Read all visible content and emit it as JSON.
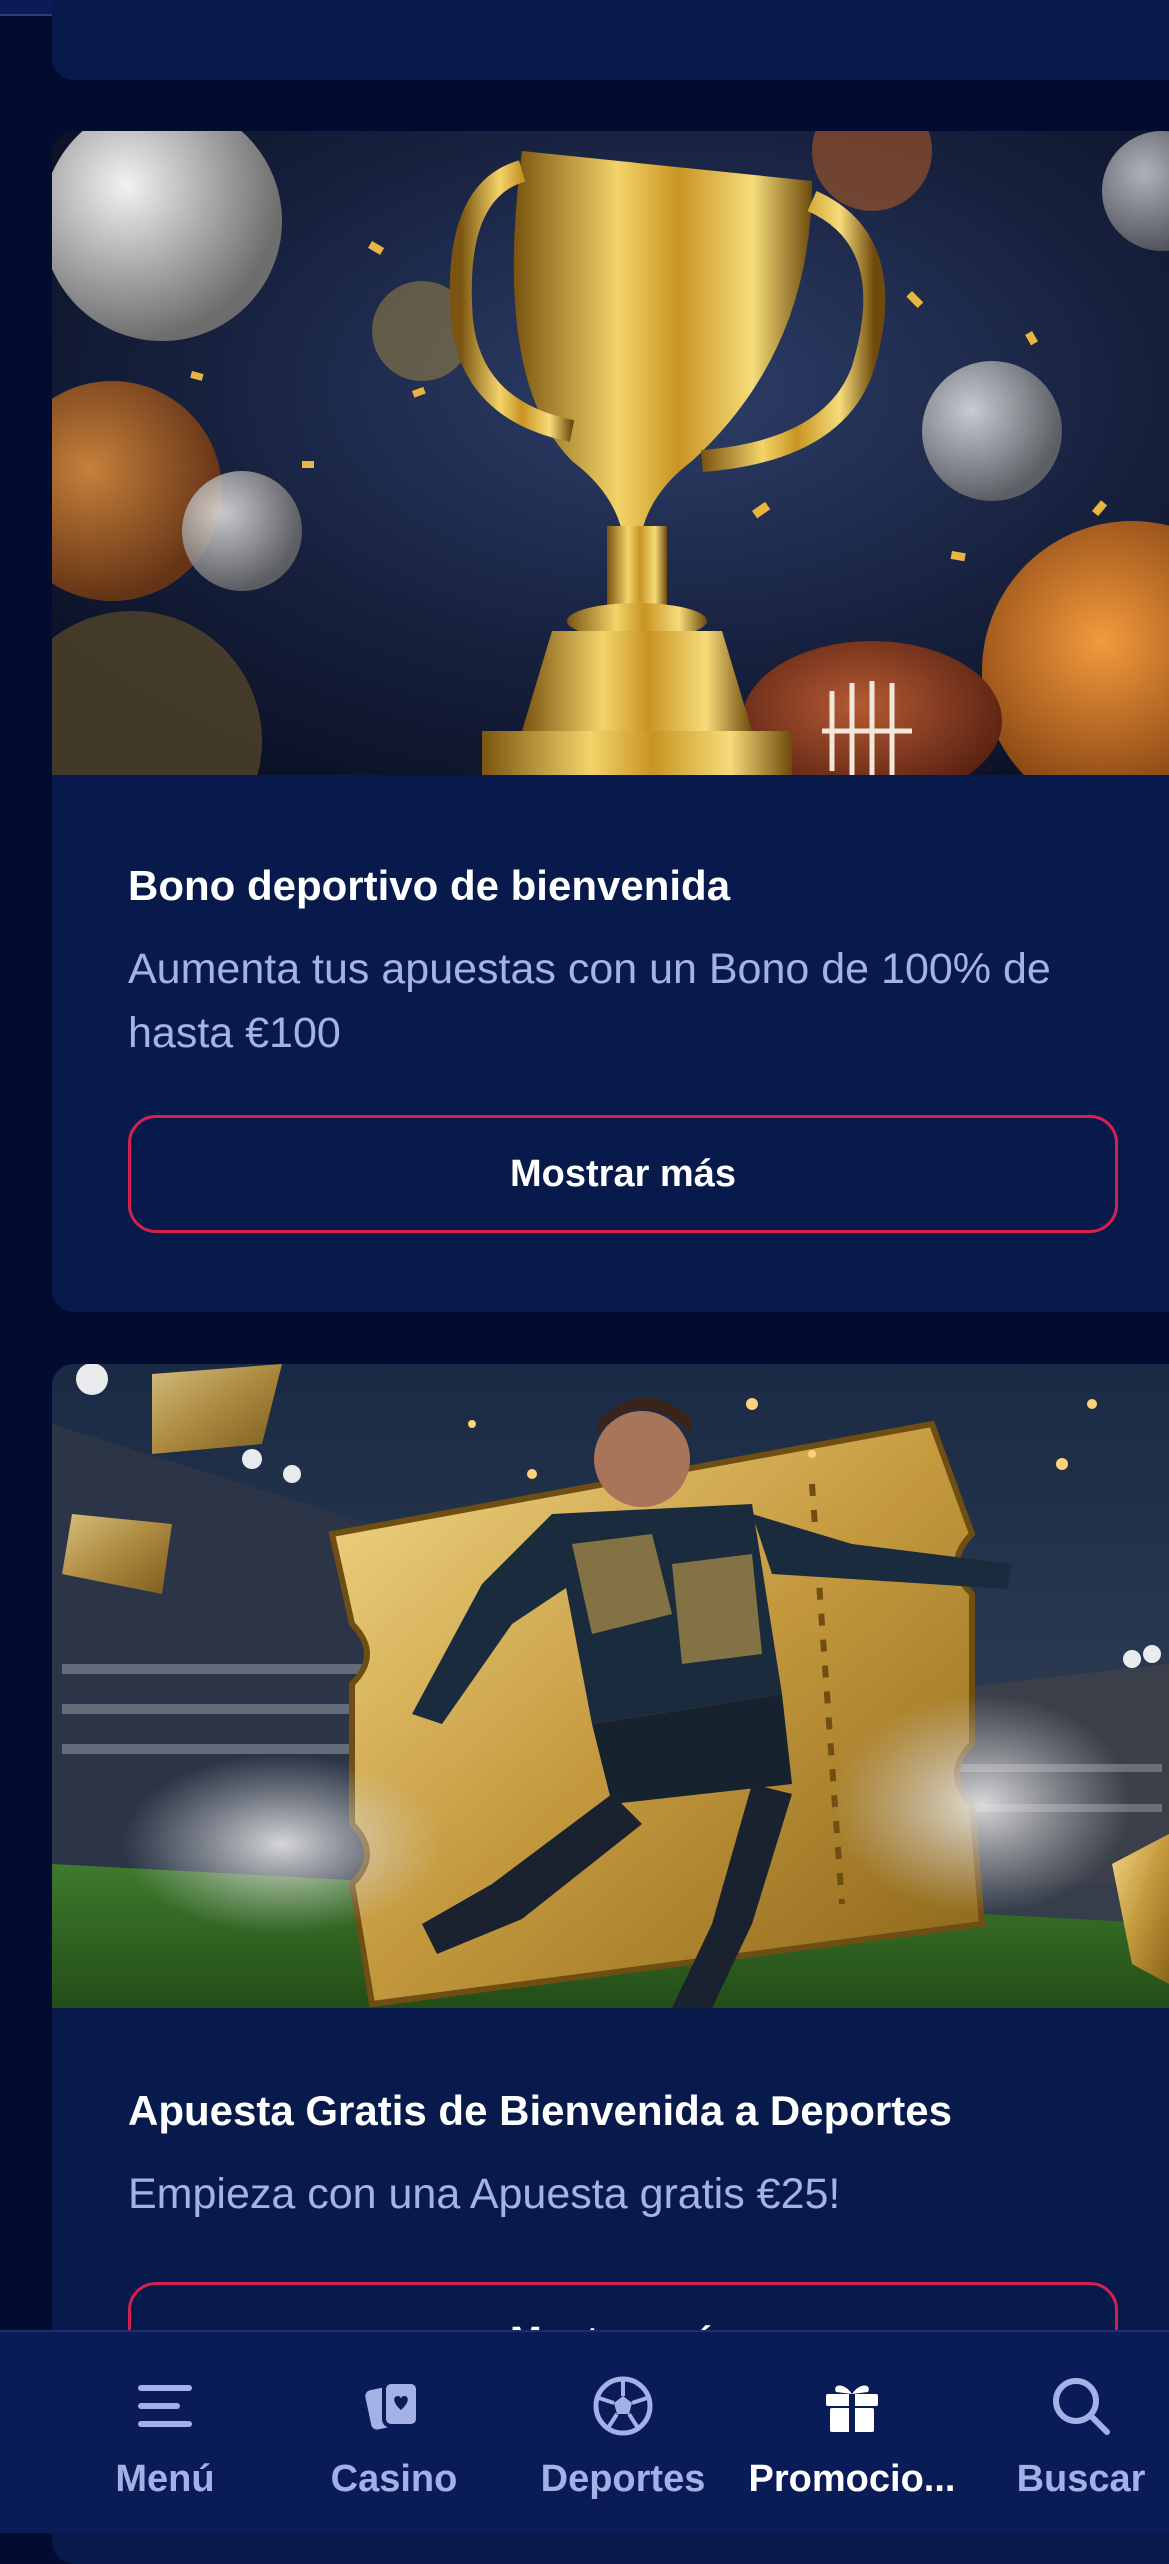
{
  "promotions": [
    {
      "title": "Bono deportivo de bienvenida",
      "description": "Aumenta tus apuestas con un Bono de 100% de hasta €100",
      "button_label": "Mostrar más",
      "image": "trophy-sports-balls"
    },
    {
      "title": "Apuesta Gratis de Bienvenida a Deportes",
      "description": "Empieza con una Apuesta gratis €25!",
      "button_label": "Mostrar más",
      "image": "footballer-golden-ticket"
    }
  ],
  "bottom_nav": {
    "items": [
      {
        "label": "Menú",
        "icon": "menu-icon",
        "active": false
      },
      {
        "label": "Casino",
        "icon": "casino-cards-icon",
        "active": false
      },
      {
        "label": "Deportes",
        "icon": "soccer-ball-icon",
        "active": false
      },
      {
        "label": "Promocio...",
        "icon": "gift-icon",
        "active": true
      },
      {
        "label": "Buscar",
        "icon": "search-icon",
        "active": false
      }
    ]
  },
  "colors": {
    "page_bg": "#020b30",
    "card_bg": "#081a4c",
    "accent_border": "#d4214f",
    "muted_text": "#a5b2e8",
    "nav_bg": "#0a1c58"
  }
}
